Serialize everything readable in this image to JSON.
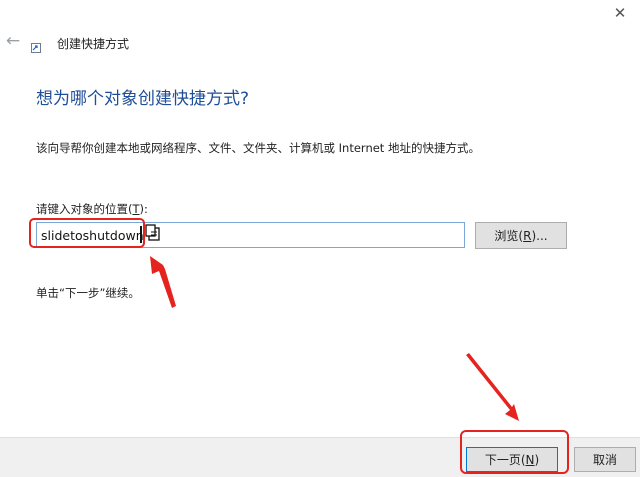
{
  "window": {
    "title": "创建快捷方式",
    "close_icon": "close-icon",
    "back_icon": "back-arrow-icon",
    "app_icon": "shortcut-icon"
  },
  "wizard": {
    "heading": "想为哪个对象创建快捷方式?",
    "description": "该向导帮你创建本地或网络程序、文件、文件夹、计算机或 Internet 地址的快捷方式。",
    "location_label_prefix": "请键入对象的位置(",
    "location_label_key": "T",
    "location_label_suffix": "):",
    "location_value": "slidetoshutdown",
    "browse_prefix": "浏览(",
    "browse_key": "R",
    "browse_suffix": ")...",
    "hint": "单击“下一步”继续。"
  },
  "footer": {
    "next_prefix": "下一页(",
    "next_key": "N",
    "next_suffix": ")",
    "cancel_label": "取消"
  },
  "annotations": {
    "highlight_color": "#e52420"
  }
}
